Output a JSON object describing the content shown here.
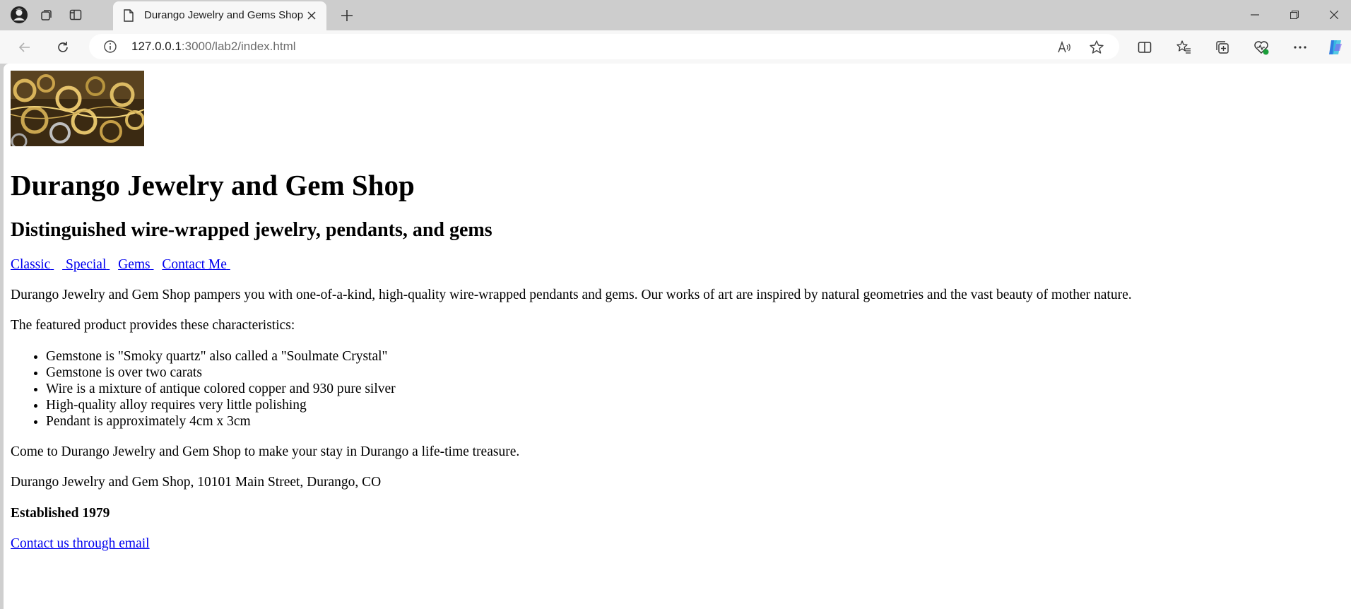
{
  "browser": {
    "tab_title": "Durango Jewelry and Gems Shop",
    "url_host": "127.0.0.1",
    "url_rest": ":3000/lab2/index.html"
  },
  "page": {
    "title": "Durango Jewelry and Gem Shop",
    "subtitle": "Distinguished wire-wrapped jewelry, pendants, and gems",
    "nav": [
      {
        "label": "Classic"
      },
      {
        "label": "Special"
      },
      {
        "label": "Gems"
      },
      {
        "label": "Contact Me"
      }
    ],
    "intro": "Durango Jewelry and Gem Shop pampers you with one-of-a-kind, high-quality wire-wrapped pendants and gems. Our works of art are inspired by natural geometries and the vast beauty of mother nature.",
    "featured_intro": "The featured product provides these characteristics:",
    "features": [
      "Gemstone is \"Smoky quartz\" also called a \"Soulmate Crystal\"",
      "Gemstone is over two carats",
      "Wire is a mixture of antique colored copper and 930 pure silver",
      "High-quality alloy requires very little polishing",
      "Pendant is approximately 4cm x 3cm"
    ],
    "closing": "Come to Durango Jewelry and Gem Shop to make your stay in Durango a life-time treasure.",
    "address": "Durango Jewelry and Gem Shop, 10101 Main Street, Durango, CO",
    "established": "Established 1979",
    "email_link": "Contact us through email"
  },
  "colors": {
    "link": "#0000ee",
    "chrome": "#cdcdcd",
    "toolbar": "#f7f7f7"
  }
}
